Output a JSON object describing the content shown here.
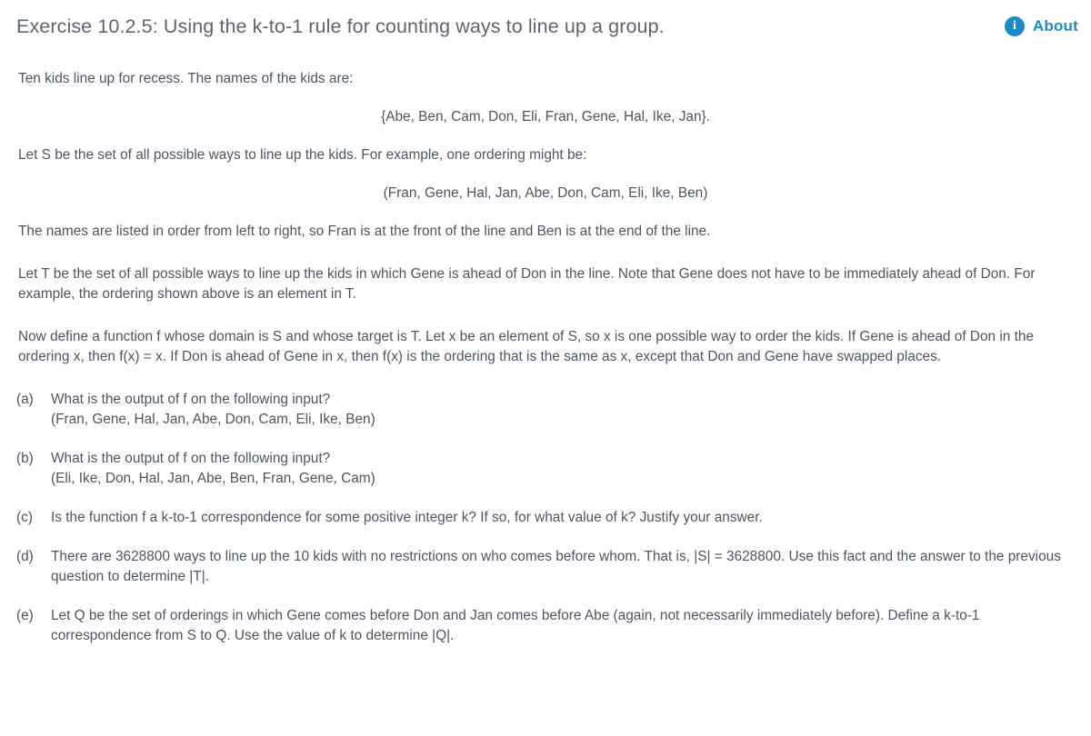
{
  "header": {
    "title": "Exercise 10.2.5: Using the k-to-1 rule for counting ways to line up a group.",
    "about_label": "About",
    "info_icon_glyph": "i",
    "accent_color": "#1e8bc9",
    "title_color": "#5b6672"
  },
  "body": {
    "intro": "Ten kids line up for recess. The names of the kids are:",
    "kid_set": "{Abe, Ben, Cam, Don, Eli, Fran, Gene, Hal, Ike, Jan}.",
    "set_s_def": "Let S be the set of all possible ways to line up the kids. For example, one ordering might be:",
    "example_ordering": "(Fran, Gene, Hal, Jan, Abe, Don, Cam, Eli, Ike, Ben)",
    "order_note": "The names are listed in order from left to right, so Fran is at the front of the line and Ben is at the end of the line.",
    "set_t_def": "Let T be the set of all possible ways to line up the kids in which Gene is ahead of Don in the line. Note that Gene does not have to be immediately ahead of Don. For example, the ordering shown above is an element in T.",
    "function_def": "Now define a function f whose domain is S and whose target is T. Let x be an element of S, so x is one possible way to order the kids. If Gene is ahead of Don in the ordering x, then f(x) = x. If Don is ahead of Gene in x, then f(x) is the ordering that is the same as x, except that Don and Gene have swapped places."
  },
  "questions": [
    {
      "label": "(a)",
      "text": "What is the output of f on the following input?",
      "line2": "(Fran, Gene, Hal, Jan, Abe, Don, Cam, Eli, Ike, Ben)"
    },
    {
      "label": "(b)",
      "text": "What is the output of f on the following input?",
      "line2": "(Eli, Ike, Don, Hal, Jan, Abe, Ben, Fran, Gene, Cam)"
    },
    {
      "label": "(c)",
      "text": "Is the function f a k-to-1 correspondence for some positive integer k? If so, for what value of k? Justify your answer.",
      "line2": ""
    },
    {
      "label": "(d)",
      "text": "There are 3628800 ways to line up the 10 kids with no restrictions on who comes before whom. That is, |S| = 3628800. Use this fact and the answer to the previous question to determine |T|.",
      "line2": ""
    },
    {
      "label": "(e)",
      "text": "Let Q be the set of orderings in which Gene comes before Don and Jan comes before Abe (again, not necessarily immediately before). Define a k-to-1 correspondence from S to Q. Use the value of k to determine |Q|.",
      "line2": ""
    }
  ]
}
